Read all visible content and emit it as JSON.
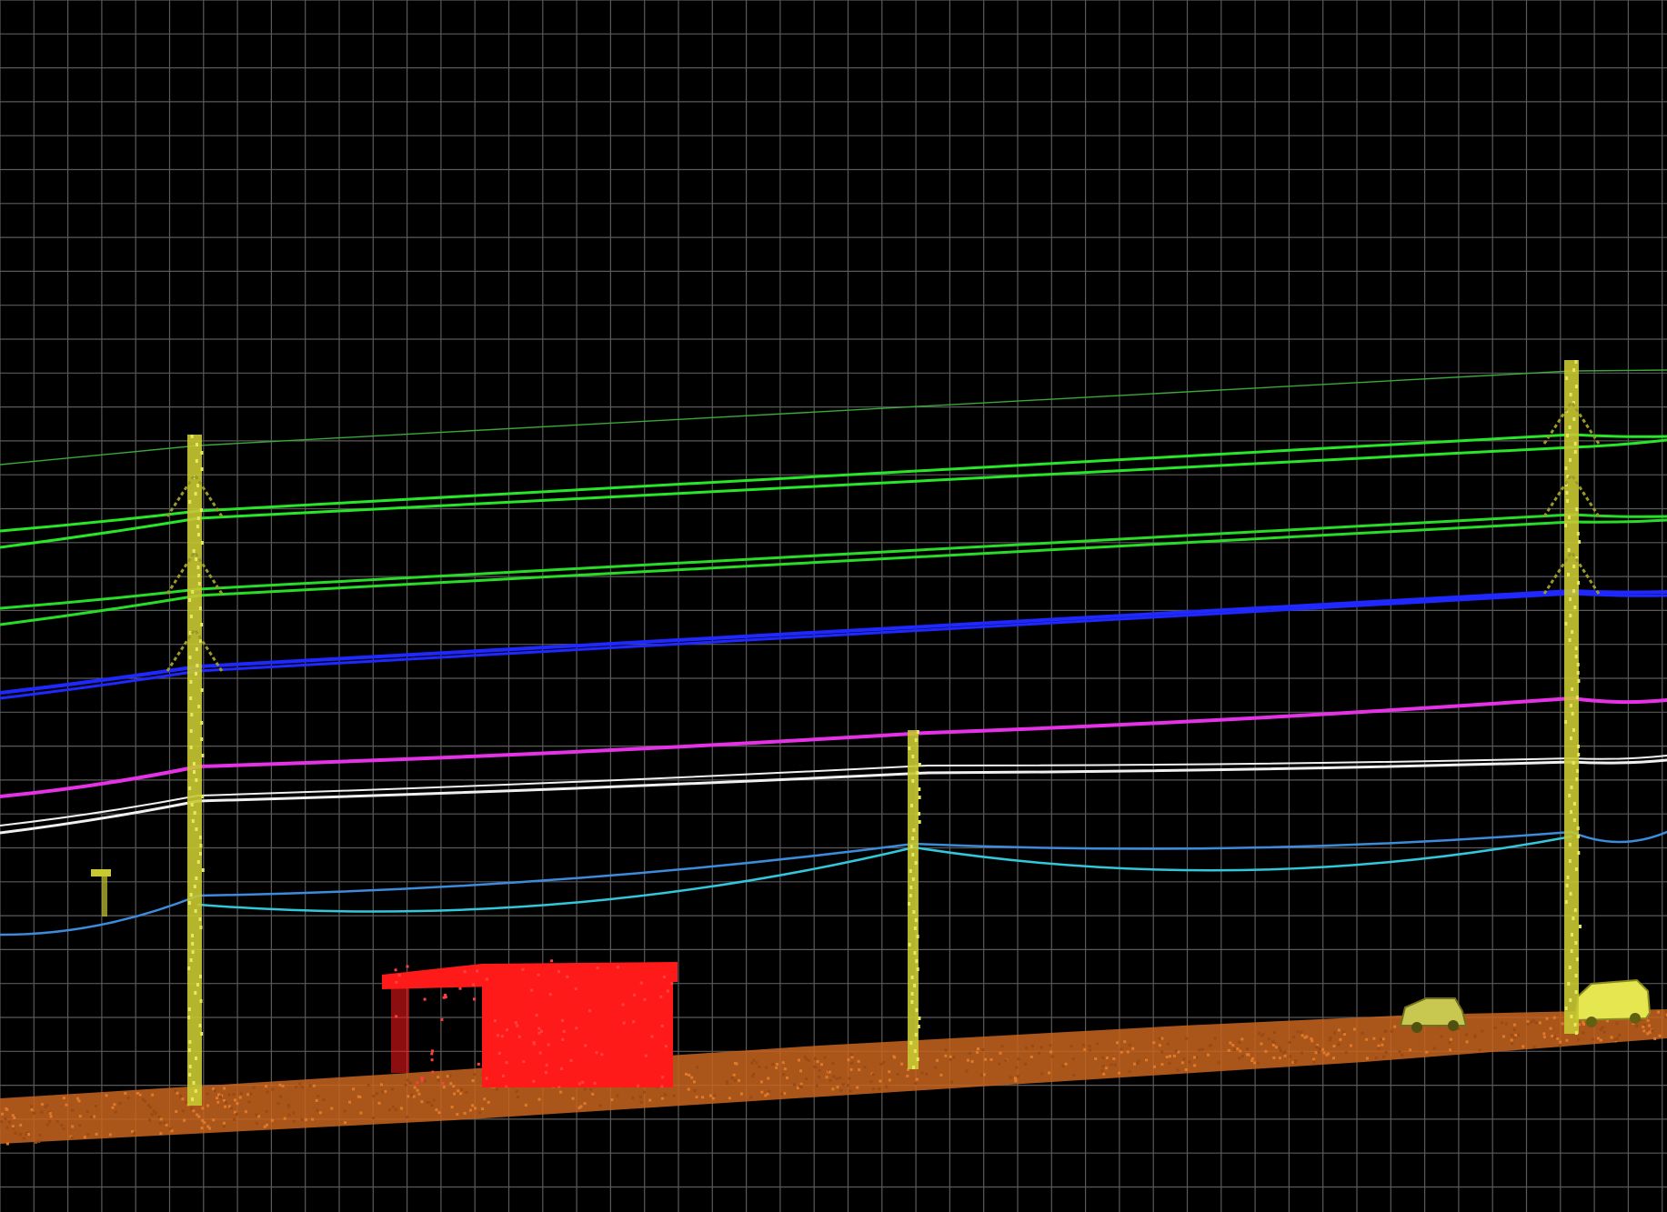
{
  "viewer": {
    "background_color": "#000000",
    "grid": {
      "visible": true,
      "color": "#5a5a5a"
    }
  },
  "scene": {
    "classes": [
      {
        "name": "ground",
        "color": "#c8641e"
      },
      {
        "name": "utility-pole",
        "color": "#c8c832"
      },
      {
        "name": "building",
        "color": "#ff1a1a"
      },
      {
        "name": "vehicle",
        "color": "#c8c850"
      },
      {
        "name": "guide-wire",
        "color": "#3aa83a"
      },
      {
        "name": "conductor-upper",
        "color": "#28e628"
      },
      {
        "name": "conductor-lower",
        "color": "#28dc28"
      },
      {
        "name": "neutral-wire",
        "color": "#1e28ff"
      },
      {
        "name": "communication-wire",
        "color": "#e632e6"
      },
      {
        "name": "telephone-wire",
        "color": "#f0f0f0"
      },
      {
        "name": "cable-upper",
        "color": "#3c8cdc"
      },
      {
        "name": "cable-lower",
        "color": "#32c8dc"
      }
    ]
  }
}
